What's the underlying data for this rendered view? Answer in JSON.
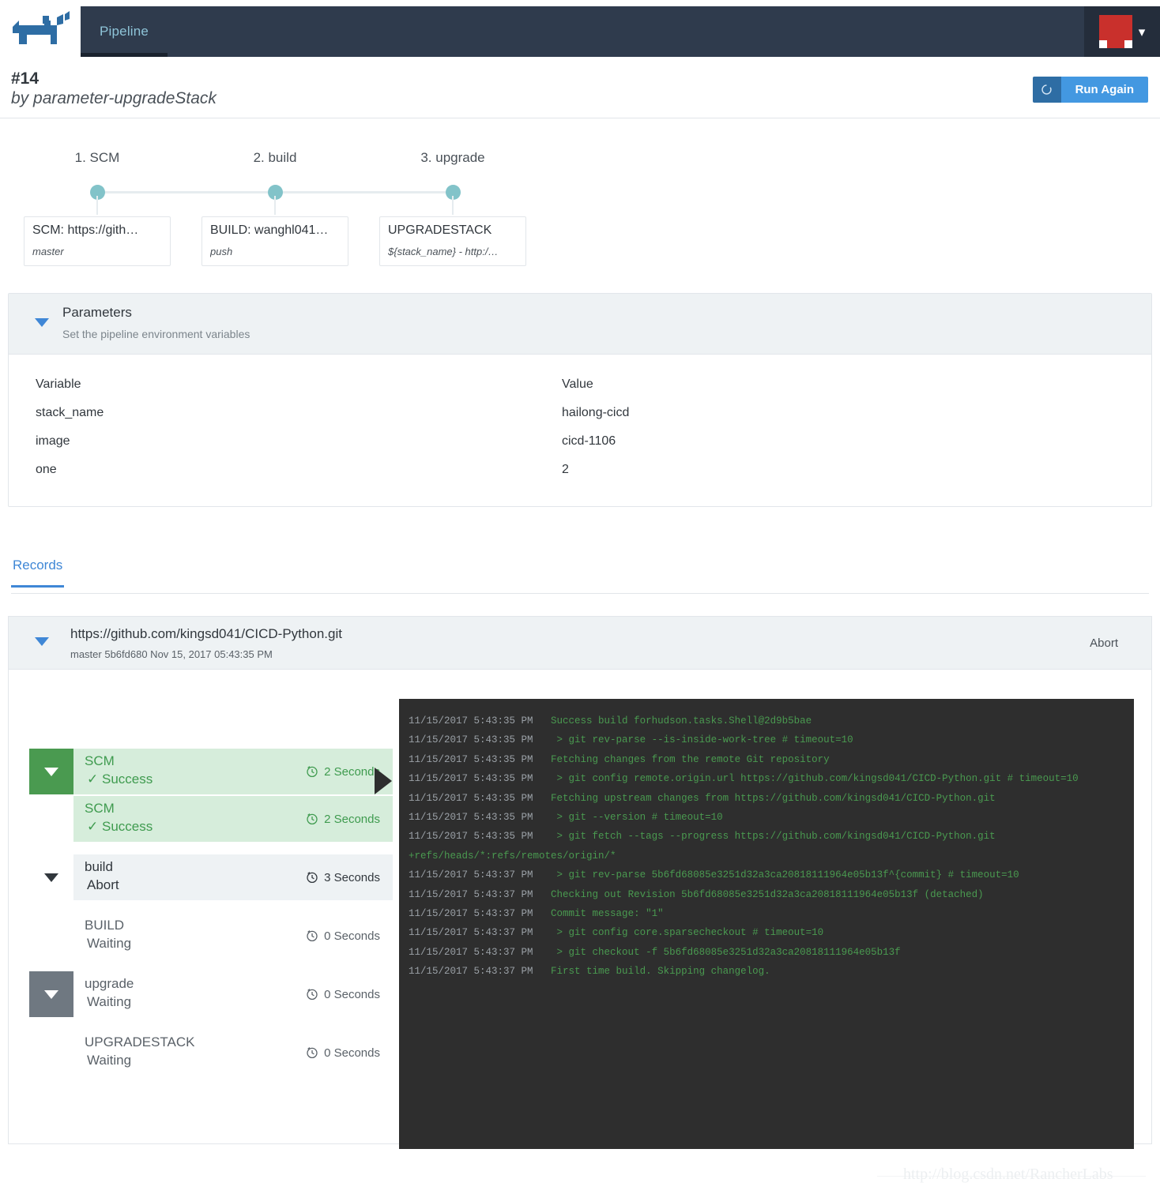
{
  "topbar": {
    "logo_icon": "rancher-cow-logo",
    "tabs": [
      {
        "label": "Pipeline",
        "active": true
      }
    ],
    "account": {
      "avatar_icon": "red-square-avatar",
      "chevron_icon": "chevron-down-icon"
    }
  },
  "header": {
    "build_number": "#14",
    "by_line": "by parameter-upgradeStack",
    "run_again_label": "Run Again",
    "spinner_icon": "refresh-spinner-icon"
  },
  "stage_graph": {
    "nodes": [
      {
        "index_label": "1. SCM",
        "card_title": "SCM: https://gith…",
        "card_sub": "master"
      },
      {
        "index_label": "2. build",
        "card_title": "BUILD: wanghl041…",
        "card_sub": "push"
      },
      {
        "index_label": "3. upgrade",
        "card_title": "UPGRADESTACK",
        "card_sub": "${stack_name} - http:/…"
      }
    ],
    "dot_color": "#82c3c9",
    "line_color": "#e6ecef"
  },
  "parameters": {
    "title": "Parameters",
    "subtitle": "Set the pipeline environment variables",
    "caret_icon": "caret-down-icon",
    "columns": {
      "variable": "Variable",
      "value": "Value"
    },
    "rows": [
      {
        "variable": "stack_name",
        "value": "hailong-cicd"
      },
      {
        "variable": "image",
        "value": "cicd-1106"
      },
      {
        "variable": "one",
        "value": "2"
      }
    ]
  },
  "records_tabs": [
    {
      "label": "Records",
      "active": true
    }
  ],
  "record": {
    "caret_icon": "caret-down-icon",
    "repo_url": "https://github.com/kingsd041/CICD-Python.git",
    "meta": "master 5b6fd680 Nov 15, 2017 05:43:35 PM",
    "abort_label": "Abort",
    "stages": [
      {
        "name": "SCM",
        "status": "Success",
        "duration": "2 Seconds",
        "tone": "green",
        "box": "green",
        "caret": "white",
        "indent": 0,
        "status_icon": "check-icon"
      },
      {
        "name": "SCM",
        "status": "Success",
        "duration": "2 Seconds",
        "tone": "green",
        "box": "none",
        "caret": "none",
        "indent": 1,
        "status_icon": "check-icon"
      },
      {
        "name": "build",
        "status": "Abort",
        "duration": "3 Seconds",
        "tone": "dark",
        "box": "plain",
        "caret": "dark",
        "indent": 0,
        "status_icon": "none"
      },
      {
        "name": "BUILD",
        "status": "Waiting",
        "duration": "0 Seconds",
        "tone": "muted",
        "box": "none",
        "caret": "none",
        "indent": 1,
        "status_icon": "none"
      },
      {
        "name": "upgrade",
        "status": "Waiting",
        "duration": "0 Seconds",
        "tone": "muted",
        "box": "grey",
        "caret": "white",
        "indent": 0,
        "status_icon": "none"
      },
      {
        "name": "UPGRADESTACK",
        "status": "Waiting",
        "duration": "0 Seconds",
        "tone": "muted",
        "box": "none",
        "caret": "none",
        "indent": 1,
        "status_icon": "none"
      }
    ],
    "console_lines": [
      {
        "time": "11/15/2017 5:43:35 PM",
        "message": "Success build forhudson.tasks.Shell@2d9b5bae",
        "indent": 0
      },
      {
        "time": "11/15/2017 5:43:35 PM",
        "message": "> git rev-parse --is-inside-work-tree # timeout=10",
        "indent": 1
      },
      {
        "time": "11/15/2017 5:43:35 PM",
        "message": "Fetching changes from the remote Git repository",
        "indent": 0
      },
      {
        "time": "11/15/2017 5:43:35 PM",
        "message": "> git config remote.origin.url https://github.com/kingsd041/CICD-Python.git # timeout=10",
        "indent": 1
      },
      {
        "time": "11/15/2017 5:43:35 PM",
        "message": "Fetching upstream changes from https://github.com/kingsd041/CICD-Python.git",
        "indent": 0
      },
      {
        "time": "11/15/2017 5:43:35 PM",
        "message": "> git --version # timeout=10",
        "indent": 1
      },
      {
        "time": "11/15/2017 5:43:35 PM",
        "message": "> git fetch --tags --progress https://github.com/kingsd041/CICD-Python.git",
        "indent": 1
      },
      {
        "time": "",
        "message": "+refs/heads/*:refs/remotes/origin/*",
        "indent": 0,
        "continuation": true
      },
      {
        "time": "11/15/2017 5:43:37 PM",
        "message": "> git rev-parse 5b6fd68085e3251d32a3ca20818111964e05b13f^{commit} # timeout=10",
        "indent": 1
      },
      {
        "time": "11/15/2017 5:43:37 PM",
        "message": "Checking out Revision 5b6fd68085e3251d32a3ca20818111964e05b13f (detached)",
        "indent": 0
      },
      {
        "time": "11/15/2017 5:43:37 PM",
        "message": "Commit message: \"1\"",
        "indent": 0
      },
      {
        "time": "11/15/2017 5:43:37 PM",
        "message": "> git config core.sparsecheckout # timeout=10",
        "indent": 1
      },
      {
        "time": "11/15/2017 5:43:37 PM",
        "message": "> git checkout -f 5b6fd68085e3251d32a3ca20818111964e05b13f",
        "indent": 1
      },
      {
        "time": "11/15/2017 5:43:37 PM",
        "message": "First time build. Skipping changelog.",
        "indent": 0
      }
    ]
  },
  "watermark": "http://blog.csdn.net/RancherLabs",
  "colors": {
    "navbar": "#2f3b4d",
    "accent_blue": "#3f87d6",
    "button_blue": "#4398e1",
    "success_green": "#4a9a50",
    "success_bg": "#d6eddb",
    "waiting_grey": "#6f7881",
    "console_bg": "#2e2e2e",
    "console_text": "#4a9a50",
    "avatar_red": "#c9302c"
  }
}
